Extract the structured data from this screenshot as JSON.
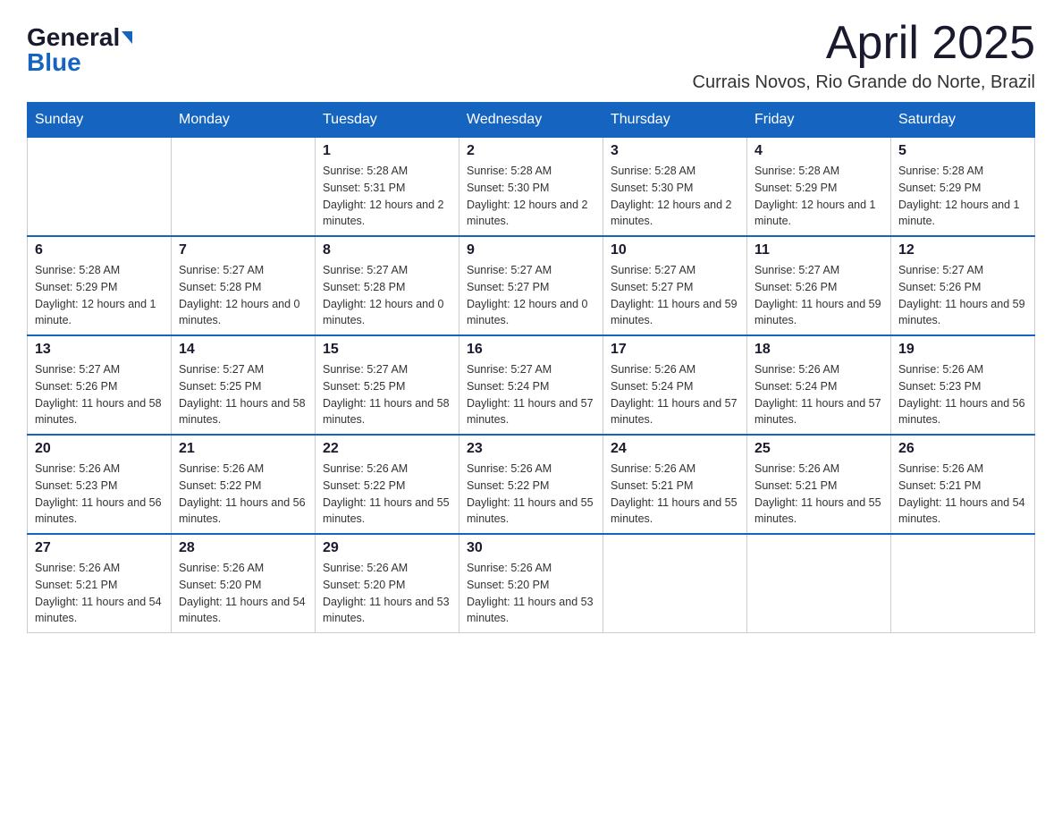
{
  "logo": {
    "general": "General",
    "blue": "Blue"
  },
  "title": "April 2025",
  "location": "Currais Novos, Rio Grande do Norte, Brazil",
  "days_of_week": [
    "Sunday",
    "Monday",
    "Tuesday",
    "Wednesday",
    "Thursday",
    "Friday",
    "Saturday"
  ],
  "weeks": [
    [
      {
        "day": "",
        "sunrise": "",
        "sunset": "",
        "daylight": ""
      },
      {
        "day": "",
        "sunrise": "",
        "sunset": "",
        "daylight": ""
      },
      {
        "day": "1",
        "sunrise": "Sunrise: 5:28 AM",
        "sunset": "Sunset: 5:31 PM",
        "daylight": "Daylight: 12 hours and 2 minutes."
      },
      {
        "day": "2",
        "sunrise": "Sunrise: 5:28 AM",
        "sunset": "Sunset: 5:30 PM",
        "daylight": "Daylight: 12 hours and 2 minutes."
      },
      {
        "day": "3",
        "sunrise": "Sunrise: 5:28 AM",
        "sunset": "Sunset: 5:30 PM",
        "daylight": "Daylight: 12 hours and 2 minutes."
      },
      {
        "day": "4",
        "sunrise": "Sunrise: 5:28 AM",
        "sunset": "Sunset: 5:29 PM",
        "daylight": "Daylight: 12 hours and 1 minute."
      },
      {
        "day": "5",
        "sunrise": "Sunrise: 5:28 AM",
        "sunset": "Sunset: 5:29 PM",
        "daylight": "Daylight: 12 hours and 1 minute."
      }
    ],
    [
      {
        "day": "6",
        "sunrise": "Sunrise: 5:28 AM",
        "sunset": "Sunset: 5:29 PM",
        "daylight": "Daylight: 12 hours and 1 minute."
      },
      {
        "day": "7",
        "sunrise": "Sunrise: 5:27 AM",
        "sunset": "Sunset: 5:28 PM",
        "daylight": "Daylight: 12 hours and 0 minutes."
      },
      {
        "day": "8",
        "sunrise": "Sunrise: 5:27 AM",
        "sunset": "Sunset: 5:28 PM",
        "daylight": "Daylight: 12 hours and 0 minutes."
      },
      {
        "day": "9",
        "sunrise": "Sunrise: 5:27 AM",
        "sunset": "Sunset: 5:27 PM",
        "daylight": "Daylight: 12 hours and 0 minutes."
      },
      {
        "day": "10",
        "sunrise": "Sunrise: 5:27 AM",
        "sunset": "Sunset: 5:27 PM",
        "daylight": "Daylight: 11 hours and 59 minutes."
      },
      {
        "day": "11",
        "sunrise": "Sunrise: 5:27 AM",
        "sunset": "Sunset: 5:26 PM",
        "daylight": "Daylight: 11 hours and 59 minutes."
      },
      {
        "day": "12",
        "sunrise": "Sunrise: 5:27 AM",
        "sunset": "Sunset: 5:26 PM",
        "daylight": "Daylight: 11 hours and 59 minutes."
      }
    ],
    [
      {
        "day": "13",
        "sunrise": "Sunrise: 5:27 AM",
        "sunset": "Sunset: 5:26 PM",
        "daylight": "Daylight: 11 hours and 58 minutes."
      },
      {
        "day": "14",
        "sunrise": "Sunrise: 5:27 AM",
        "sunset": "Sunset: 5:25 PM",
        "daylight": "Daylight: 11 hours and 58 minutes."
      },
      {
        "day": "15",
        "sunrise": "Sunrise: 5:27 AM",
        "sunset": "Sunset: 5:25 PM",
        "daylight": "Daylight: 11 hours and 58 minutes."
      },
      {
        "day": "16",
        "sunrise": "Sunrise: 5:27 AM",
        "sunset": "Sunset: 5:24 PM",
        "daylight": "Daylight: 11 hours and 57 minutes."
      },
      {
        "day": "17",
        "sunrise": "Sunrise: 5:26 AM",
        "sunset": "Sunset: 5:24 PM",
        "daylight": "Daylight: 11 hours and 57 minutes."
      },
      {
        "day": "18",
        "sunrise": "Sunrise: 5:26 AM",
        "sunset": "Sunset: 5:24 PM",
        "daylight": "Daylight: 11 hours and 57 minutes."
      },
      {
        "day": "19",
        "sunrise": "Sunrise: 5:26 AM",
        "sunset": "Sunset: 5:23 PM",
        "daylight": "Daylight: 11 hours and 56 minutes."
      }
    ],
    [
      {
        "day": "20",
        "sunrise": "Sunrise: 5:26 AM",
        "sunset": "Sunset: 5:23 PM",
        "daylight": "Daylight: 11 hours and 56 minutes."
      },
      {
        "day": "21",
        "sunrise": "Sunrise: 5:26 AM",
        "sunset": "Sunset: 5:22 PM",
        "daylight": "Daylight: 11 hours and 56 minutes."
      },
      {
        "day": "22",
        "sunrise": "Sunrise: 5:26 AM",
        "sunset": "Sunset: 5:22 PM",
        "daylight": "Daylight: 11 hours and 55 minutes."
      },
      {
        "day": "23",
        "sunrise": "Sunrise: 5:26 AM",
        "sunset": "Sunset: 5:22 PM",
        "daylight": "Daylight: 11 hours and 55 minutes."
      },
      {
        "day": "24",
        "sunrise": "Sunrise: 5:26 AM",
        "sunset": "Sunset: 5:21 PM",
        "daylight": "Daylight: 11 hours and 55 minutes."
      },
      {
        "day": "25",
        "sunrise": "Sunrise: 5:26 AM",
        "sunset": "Sunset: 5:21 PM",
        "daylight": "Daylight: 11 hours and 55 minutes."
      },
      {
        "day": "26",
        "sunrise": "Sunrise: 5:26 AM",
        "sunset": "Sunset: 5:21 PM",
        "daylight": "Daylight: 11 hours and 54 minutes."
      }
    ],
    [
      {
        "day": "27",
        "sunrise": "Sunrise: 5:26 AM",
        "sunset": "Sunset: 5:21 PM",
        "daylight": "Daylight: 11 hours and 54 minutes."
      },
      {
        "day": "28",
        "sunrise": "Sunrise: 5:26 AM",
        "sunset": "Sunset: 5:20 PM",
        "daylight": "Daylight: 11 hours and 54 minutes."
      },
      {
        "day": "29",
        "sunrise": "Sunrise: 5:26 AM",
        "sunset": "Sunset: 5:20 PM",
        "daylight": "Daylight: 11 hours and 53 minutes."
      },
      {
        "day": "30",
        "sunrise": "Sunrise: 5:26 AM",
        "sunset": "Sunset: 5:20 PM",
        "daylight": "Daylight: 11 hours and 53 minutes."
      },
      {
        "day": "",
        "sunrise": "",
        "sunset": "",
        "daylight": ""
      },
      {
        "day": "",
        "sunrise": "",
        "sunset": "",
        "daylight": ""
      },
      {
        "day": "",
        "sunrise": "",
        "sunset": "",
        "daylight": ""
      }
    ]
  ]
}
